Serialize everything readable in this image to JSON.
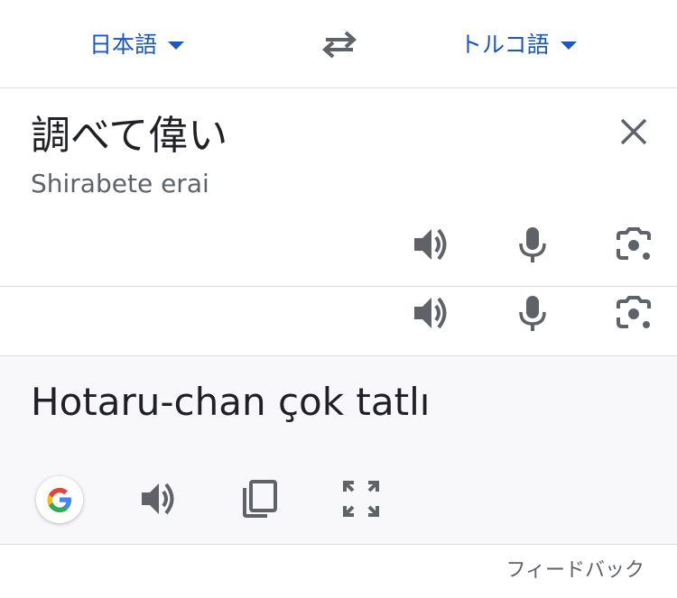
{
  "language_bar": {
    "source_language": "日本語",
    "target_language": "トルコ語",
    "accent_color": "#1a56c5"
  },
  "source": {
    "text": "調べて偉い",
    "romanization": "Shirabete erai"
  },
  "translation": {
    "text": "Hotaru-chan çok tatlı",
    "background_color": "#f8f8fa"
  },
  "footer": {
    "feedback_label": "フィードバック"
  },
  "icons": {
    "swap": "swap-languages-icon",
    "clear": "close-icon",
    "speak": "speaker-icon",
    "mic": "microphone-icon",
    "camera": "camera-lens-icon",
    "google": "google-logo-icon",
    "copy": "copy-icon",
    "fullscreen": "fullscreen-icon"
  }
}
